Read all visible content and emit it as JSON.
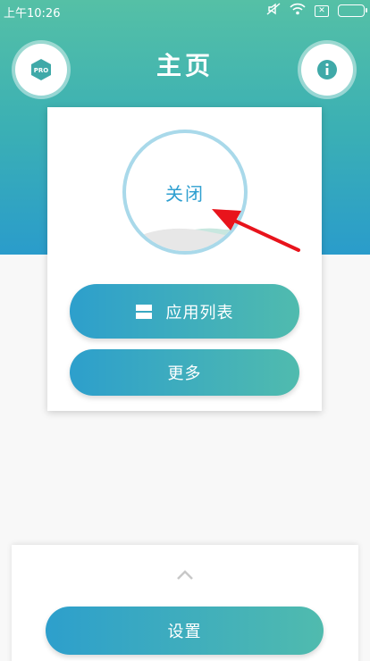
{
  "status_bar": {
    "time": "上午10:26"
  },
  "header": {
    "title": "主页",
    "pro_badge": "PRO"
  },
  "main_card": {
    "toggle_label": "关闭",
    "app_list_label": "应用列表",
    "more_label": "更多"
  },
  "bottom_sheet": {
    "settings_label": "设置"
  },
  "colors": {
    "header_gradient_top": "#55c0a6",
    "header_gradient_bottom": "#2a9ccb",
    "button_gradient_left": "#2d9fcc",
    "button_gradient_right": "#50bbae",
    "toggle_text": "#2e9fd0",
    "annotation_arrow": "#e8141c"
  },
  "icons": {
    "pro": "pro-hexagon-icon",
    "info": "info-icon",
    "app_list": "list-icon",
    "expand": "chevron-up-icon"
  }
}
